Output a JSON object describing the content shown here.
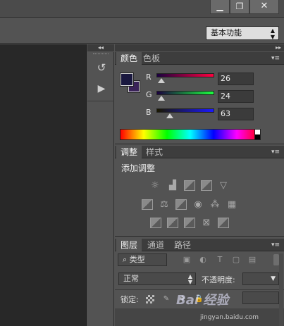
{
  "window": {
    "controls": {
      "minimize_icon": "▁",
      "restore_icon": "❐",
      "close_icon": "✕"
    }
  },
  "options_bar": {
    "workspace": "基本功能"
  },
  "dock": {
    "collapse_icon": "◂◂",
    "history_icon": "↺",
    "actions_icon": "▶"
  },
  "panels_header": {
    "expand_icon": "▸▸"
  },
  "color_panel": {
    "tabs": [
      "颜色",
      "色板"
    ],
    "foreground": "#1a183f",
    "background": "#3a2258",
    "channels": [
      {
        "label": "R",
        "value": "26"
      },
      {
        "label": "G",
        "value": "24"
      },
      {
        "label": "B",
        "value": "63"
      }
    ]
  },
  "adjustments_panel": {
    "tabs": [
      "调整",
      "样式"
    ],
    "heading": "添加调整"
  },
  "layers_panel": {
    "tabs": [
      "图层",
      "通道",
      "路径"
    ],
    "filter_label": "类型",
    "blend_mode": "正常",
    "opacity_label": "不透明度:",
    "lock_label": "锁定:"
  },
  "watermark": {
    "brand": "Bai 经验",
    "url": "jingyan.baidu.com"
  },
  "colors": {
    "panel_bg": "#535353",
    "canvas_bg": "#282828",
    "tab_bar": "#3d3d3d"
  }
}
